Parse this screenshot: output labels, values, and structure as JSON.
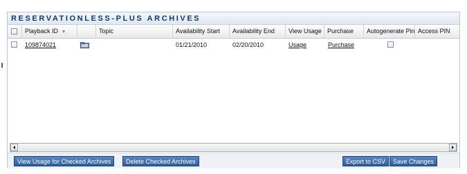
{
  "panel": {
    "title": "RESERVATIONLESS-PLUS ARCHIVES"
  },
  "table": {
    "columns": {
      "playback_id": "Playback ID",
      "topic": "Topic",
      "availability_start": "Availability Start",
      "availability_end": "Availability End",
      "view_usage": "View Usage",
      "purchase": "Purchase",
      "autogenerate_pin": "Autogenerate Pin",
      "access_pin": "Access PIN"
    },
    "sort_indicator": "▼",
    "rows": [
      {
        "playback_id": "109874021",
        "topic": "",
        "availability_start": "01/21/2010",
        "availability_end": "02/20/2010",
        "view_usage": "Usage",
        "purchase": "Purchase",
        "access_pin": ""
      }
    ]
  },
  "footer": {
    "view_usage_checked": "View Usage for Checked Archives",
    "delete_checked": "Delete Checked Archives",
    "export_csv": "Export to CSV",
    "save_changes": "Save Changes"
  },
  "icons": {
    "row_icon": "folder-icon"
  },
  "colors": {
    "title_text": "#0f3a6b",
    "button_bg": "#2f5d9c"
  }
}
